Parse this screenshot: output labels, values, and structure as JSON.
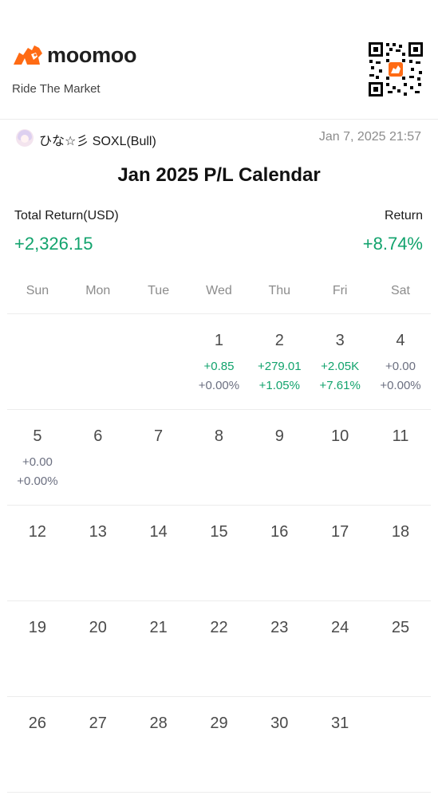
{
  "brand": {
    "name": "moomoo",
    "tagline": "Ride The Market",
    "accent": "#ff6b14"
  },
  "post": {
    "username": "ひな☆彡 SOXL(Bull)",
    "timestamp": "Jan 7, 2025 21:57"
  },
  "calendar_title": "Jan 2025 P/L Calendar",
  "summary": {
    "total_return_label": "Total Return(USD)",
    "total_return_value": "+2,326.15",
    "return_label": "Return",
    "return_value": "+8.74%",
    "positive_color": "#12a36d"
  },
  "weekdays": [
    "Sun",
    "Mon",
    "Tue",
    "Wed",
    "Thu",
    "Fri",
    "Sat"
  ],
  "weeks": [
    [
      {
        "day": "",
        "pl": "",
        "pct": "",
        "tone": ""
      },
      {
        "day": "",
        "pl": "",
        "pct": "",
        "tone": ""
      },
      {
        "day": "",
        "pl": "",
        "pct": "",
        "tone": ""
      },
      {
        "day": "1",
        "pl": "+0.85",
        "pct": "+0.00%",
        "tone": "pos-flat"
      },
      {
        "day": "2",
        "pl": "+279.01",
        "pct": "+1.05%",
        "tone": "pos"
      },
      {
        "day": "3",
        "pl": "+2.05K",
        "pct": "+7.61%",
        "tone": "pos"
      },
      {
        "day": "4",
        "pl": "+0.00",
        "pct": "+0.00%",
        "tone": "flat"
      }
    ],
    [
      {
        "day": "5",
        "pl": "+0.00",
        "pct": "+0.00%",
        "tone": "flat"
      },
      {
        "day": "6",
        "pl": "",
        "pct": "",
        "tone": ""
      },
      {
        "day": "7",
        "pl": "",
        "pct": "",
        "tone": ""
      },
      {
        "day": "8",
        "pl": "",
        "pct": "",
        "tone": ""
      },
      {
        "day": "9",
        "pl": "",
        "pct": "",
        "tone": ""
      },
      {
        "day": "10",
        "pl": "",
        "pct": "",
        "tone": ""
      },
      {
        "day": "11",
        "pl": "",
        "pct": "",
        "tone": ""
      }
    ],
    [
      {
        "day": "12",
        "pl": "",
        "pct": "",
        "tone": ""
      },
      {
        "day": "13",
        "pl": "",
        "pct": "",
        "tone": ""
      },
      {
        "day": "14",
        "pl": "",
        "pct": "",
        "tone": ""
      },
      {
        "day": "15",
        "pl": "",
        "pct": "",
        "tone": ""
      },
      {
        "day": "16",
        "pl": "",
        "pct": "",
        "tone": ""
      },
      {
        "day": "17",
        "pl": "",
        "pct": "",
        "tone": ""
      },
      {
        "day": "18",
        "pl": "",
        "pct": "",
        "tone": ""
      }
    ],
    [
      {
        "day": "19",
        "pl": "",
        "pct": "",
        "tone": ""
      },
      {
        "day": "20",
        "pl": "",
        "pct": "",
        "tone": ""
      },
      {
        "day": "21",
        "pl": "",
        "pct": "",
        "tone": ""
      },
      {
        "day": "22",
        "pl": "",
        "pct": "",
        "tone": ""
      },
      {
        "day": "23",
        "pl": "",
        "pct": "",
        "tone": ""
      },
      {
        "day": "24",
        "pl": "",
        "pct": "",
        "tone": ""
      },
      {
        "day": "25",
        "pl": "",
        "pct": "",
        "tone": ""
      }
    ],
    [
      {
        "day": "26",
        "pl": "",
        "pct": "",
        "tone": ""
      },
      {
        "day": "27",
        "pl": "",
        "pct": "",
        "tone": ""
      },
      {
        "day": "28",
        "pl": "",
        "pct": "",
        "tone": ""
      },
      {
        "day": "29",
        "pl": "",
        "pct": "",
        "tone": ""
      },
      {
        "day": "30",
        "pl": "",
        "pct": "",
        "tone": ""
      },
      {
        "day": "31",
        "pl": "",
        "pct": "",
        "tone": ""
      },
      {
        "day": "",
        "pl": "",
        "pct": "",
        "tone": ""
      }
    ]
  ],
  "icons": {
    "logo": "moomoo-bull-logo-icon",
    "qr": "qr-code-icon",
    "avatar": "user-avatar"
  }
}
